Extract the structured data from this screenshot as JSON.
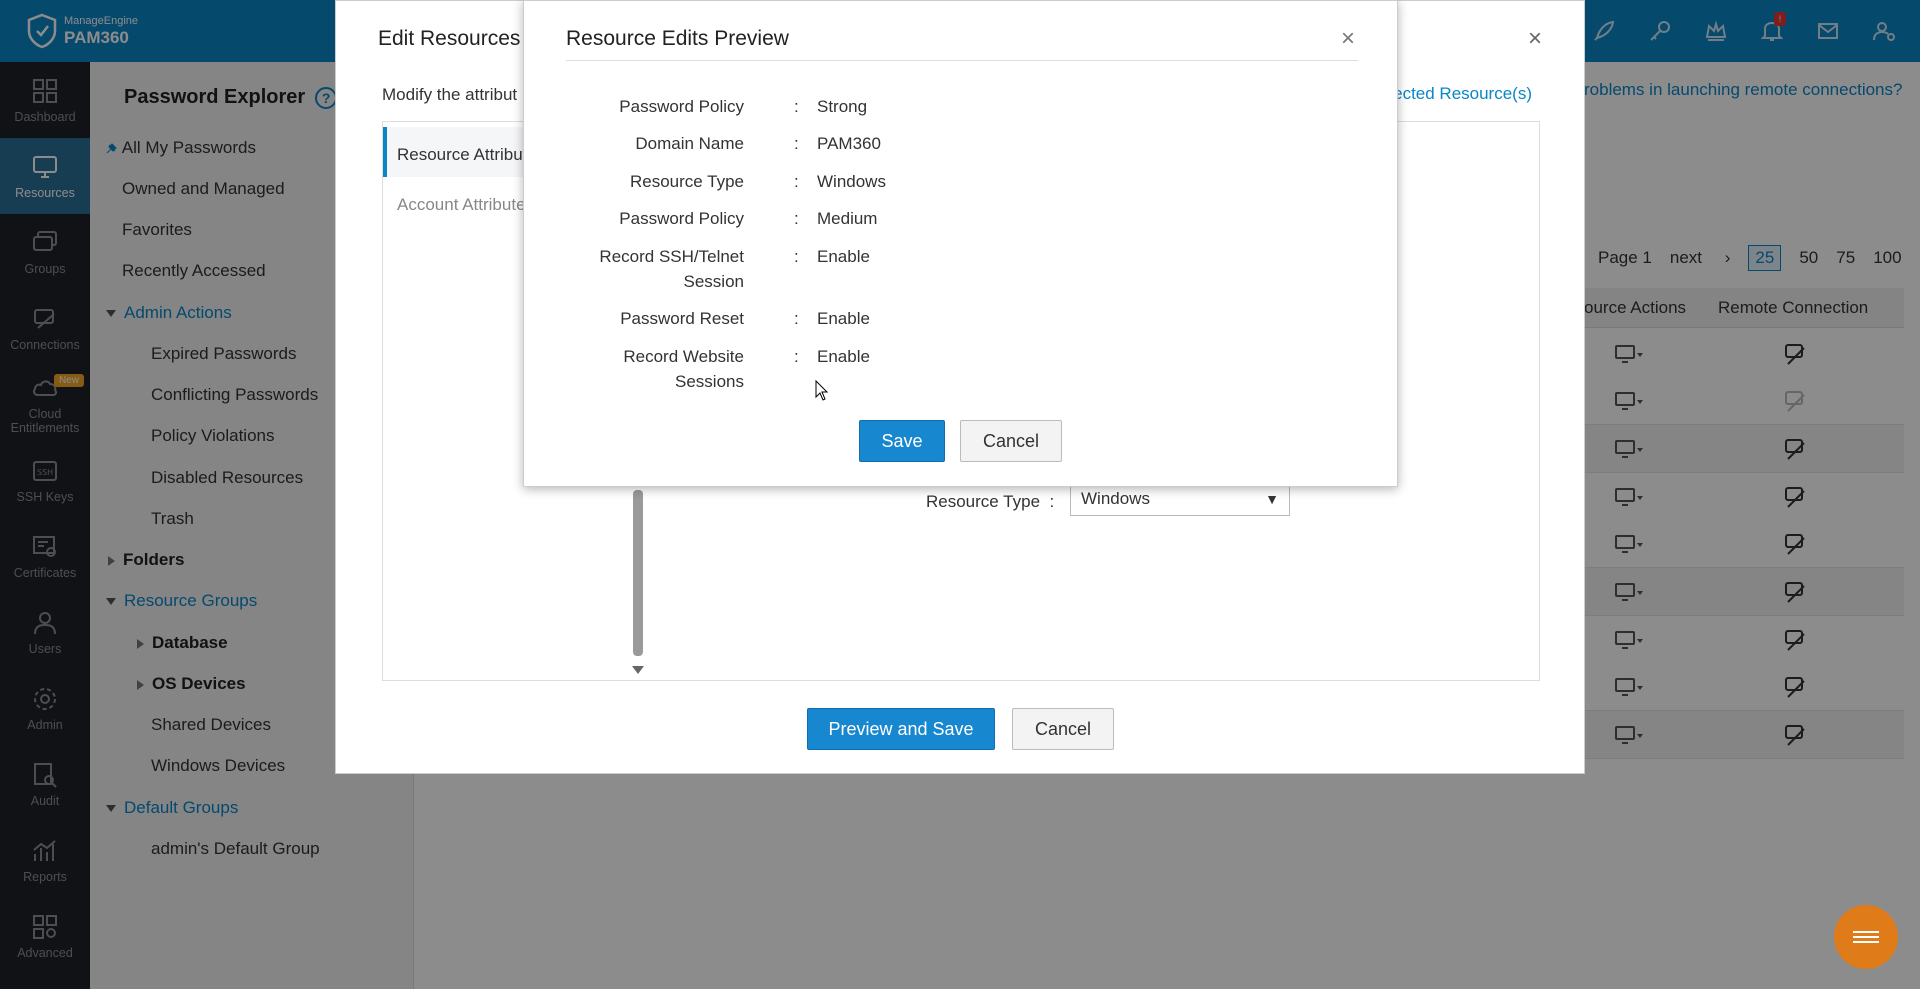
{
  "app": {
    "brand_small": "ManageEngine",
    "brand": "PAM360"
  },
  "rail": [
    {
      "label": "Dashboard",
      "icon": "dashboard-icon"
    },
    {
      "label": "Resources",
      "icon": "monitor-icon",
      "active": true
    },
    {
      "label": "Groups",
      "icon": "groups-icon"
    },
    {
      "label": "Connections",
      "icon": "connections-icon"
    },
    {
      "label": "Cloud Entitlements",
      "icon": "cloud-icon",
      "badge": "New"
    },
    {
      "label": "SSH Keys",
      "icon": "ssh-icon"
    },
    {
      "label": "Certificates",
      "icon": "certificate-icon"
    },
    {
      "label": "Users",
      "icon": "user-icon"
    },
    {
      "label": "Admin",
      "icon": "gear-icon"
    },
    {
      "label": "Audit",
      "icon": "audit-icon"
    },
    {
      "label": "Reports",
      "icon": "reports-icon"
    },
    {
      "label": "Advanced",
      "icon": "advanced-icon"
    }
  ],
  "sidebar": {
    "title": "Password Explorer",
    "help": "?",
    "all_my_passwords": "All My Passwords",
    "owned": "Owned and Managed",
    "favorites": "Favorites",
    "recent": "Recently Accessed",
    "admin_actions": "Admin Actions",
    "expired": "Expired Passwords",
    "conflicting": "Conflicting Passwords",
    "policy": "Policy Violations",
    "disabled": "Disabled Resources",
    "trash": "Trash",
    "folders": "Folders",
    "resource_groups": "Resource Groups",
    "database": "Database",
    "os_devices": "OS Devices",
    "shared": "Shared Devices",
    "windows": "Windows Devices",
    "default_groups": "Default Groups",
    "admin_default": "admin's Default Group"
  },
  "main": {
    "remote_note": "roblems in launching remote connections?",
    "pager": {
      "page": "Page 1",
      "next": "next",
      "sizes": [
        "25",
        "50",
        "75",
        "100"
      ]
    },
    "headers": {
      "actions": "ource Actions",
      "remote": "Remote Connection"
    }
  },
  "edit_modal": {
    "title": "Edit Resources",
    "close": "×",
    "desc": "Modify the attribut",
    "link": "ected Resource(s)",
    "tab1": "Resource Attribut",
    "tab2": "Account Attribute",
    "resource_type_label": "Resource Type",
    "colon": ":",
    "resource_type_value": "Windows",
    "preview_save": "Preview and Save",
    "cancel": "Cancel"
  },
  "preview": {
    "title": "Resource Edits Preview",
    "close": "×",
    "rows": [
      {
        "label": "Password Policy",
        "value": "Strong"
      },
      {
        "label": "Domain Name",
        "value": "PAM360"
      },
      {
        "label": "Resource Type",
        "value": "Windows"
      },
      {
        "label": "Password Policy",
        "value": "Medium"
      },
      {
        "label": "Record SSH/Telnet Session",
        "value": "Enable"
      },
      {
        "label": "Password Reset",
        "value": "Enable"
      },
      {
        "label": "Record Website Sessions",
        "value": "Enable"
      }
    ],
    "colon": ":",
    "save": "Save",
    "cancel": "Cancel"
  },
  "colors": {
    "header": "#0a86c7",
    "rail": "#1f2227",
    "primary": "#1787d0",
    "fab": "#e07b1a"
  }
}
